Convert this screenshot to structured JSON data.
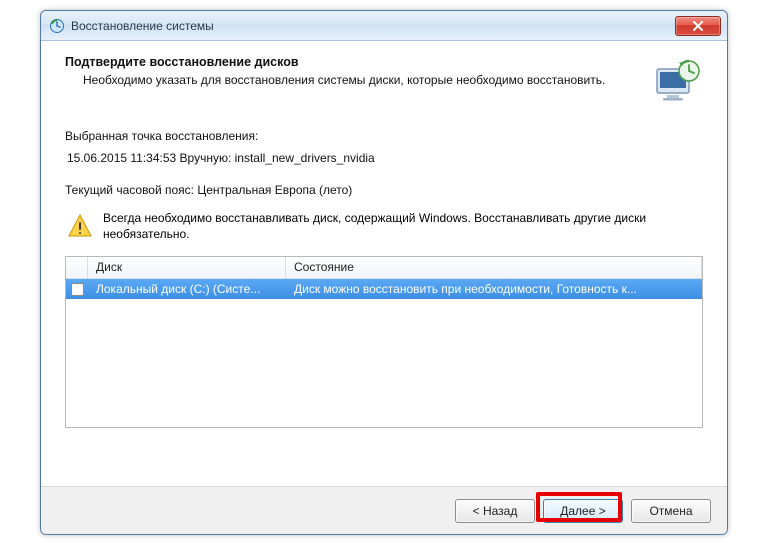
{
  "window": {
    "title": "Восстановление системы"
  },
  "header": {
    "title": "Подтвердите восстановление дисков",
    "subtitle": "Необходимо указать для восстановления системы диски, которые необходимо восстановить."
  },
  "restore_point": {
    "label": "Выбранная точка восстановления:",
    "value": "15.06.2015 11:34:53 Вручную: install_new_drivers_nvidia"
  },
  "timezone": {
    "text": "Текущий часовой пояс: Центральная Европа (лето)"
  },
  "warning": {
    "text": "Всегда необходимо восстанавливать диск, содержащий Windows. Восстанавливать другие диски необязательно."
  },
  "list": {
    "columns": {
      "disk": "Диск",
      "status": "Состояние"
    },
    "rows": [
      {
        "checked": false,
        "disk": "Локальный диск (C:) (Систе...",
        "status": "Диск можно восстановить при необходимости, Готовность к...",
        "selected": true
      }
    ]
  },
  "buttons": {
    "back": "< Назад",
    "next": "Далее >",
    "cancel": "Отмена"
  },
  "icons": {
    "app": "restore-icon",
    "header": "monitor-restore-icon",
    "warning": "warning-icon",
    "close": "close-icon"
  }
}
